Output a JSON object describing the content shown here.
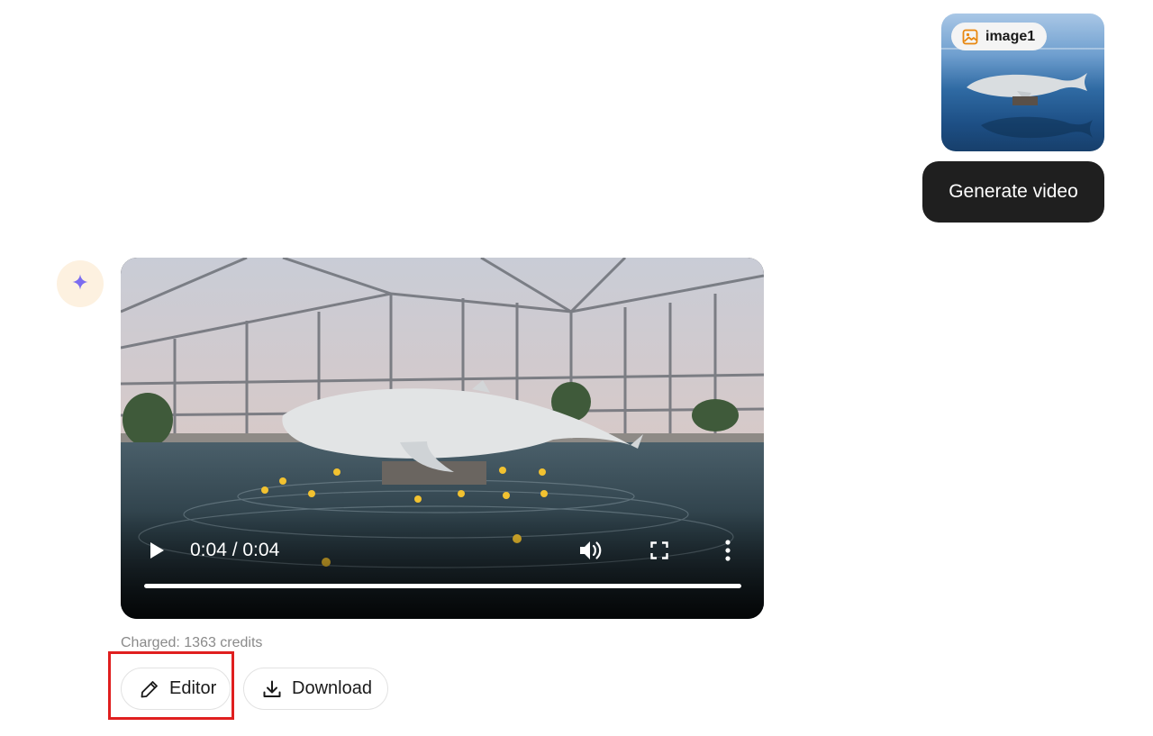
{
  "user_message": {
    "attachment": {
      "label": "image1",
      "icon": "image-icon",
      "icon_color": "#e8870e"
    },
    "text": "Generate video",
    "bubble_color": "#1f1f1f"
  },
  "assistant_message": {
    "avatar_icon": "sparkle-icon",
    "avatar_color": "#7b6cf0",
    "video": {
      "time_display": "0:04 / 0:04",
      "progress": 1.0,
      "controls": [
        "play-icon",
        "volume-icon",
        "fullscreen-icon",
        "more-vertical-icon"
      ]
    },
    "charged_text": "Charged: 1363 credits",
    "actions": {
      "editor_label": "Editor",
      "editor_icon": "pencil-icon",
      "download_label": "Download",
      "download_icon": "download-icon"
    }
  },
  "annotation": {
    "highlight_color": "#e01f1f",
    "highlight_target": "editor-button"
  }
}
